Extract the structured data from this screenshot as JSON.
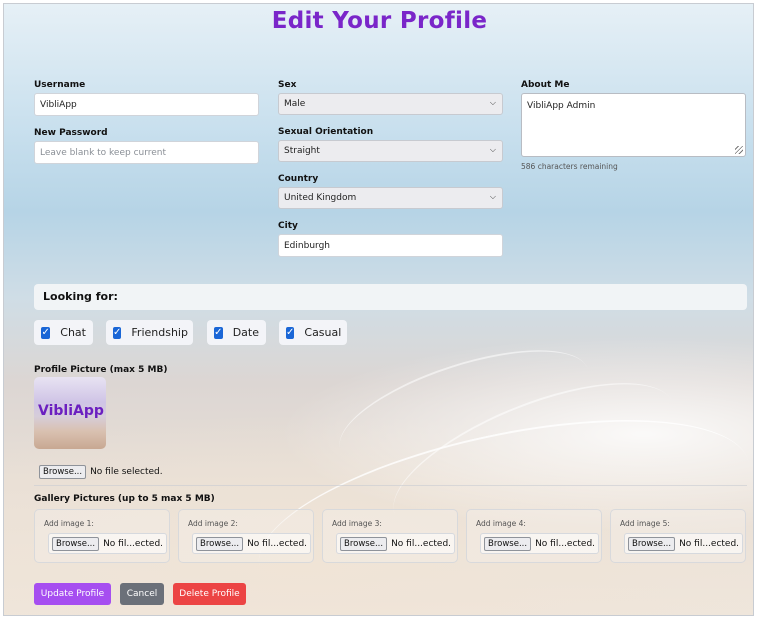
{
  "page_title": "Edit Your Profile",
  "username": {
    "label": "Username",
    "value": "VibliApp"
  },
  "new_password": {
    "label": "New Password",
    "placeholder": "Leave blank to keep current"
  },
  "sex": {
    "label": "Sex",
    "value": "Male"
  },
  "orientation": {
    "label": "Sexual Orientation",
    "value": "Straight"
  },
  "country": {
    "label": "Country",
    "value": "United Kingdom"
  },
  "city": {
    "label": "City",
    "value": "Edinburgh"
  },
  "about": {
    "label": "About Me",
    "value": "VibliApp Admin",
    "remaining": "586 characters remaining"
  },
  "looking_for": {
    "title": "Looking for:",
    "options": [
      {
        "label": "Chat",
        "checked": true
      },
      {
        "label": "Friendship",
        "checked": true
      },
      {
        "label": "Date",
        "checked": true
      },
      {
        "label": "Casual",
        "checked": true
      }
    ]
  },
  "profile_picture": {
    "label": "Profile Picture (max 5 MB)",
    "image_text": "VibliApp",
    "browse": "Browse...",
    "file_status": "No file selected."
  },
  "gallery": {
    "label": "Gallery Pictures (up to 5 max 5 MB)",
    "slots": [
      {
        "label": "Add image 1:",
        "browse": "Browse...",
        "status": "No fil...ected."
      },
      {
        "label": "Add image 2:",
        "browse": "Browse...",
        "status": "No fil...ected."
      },
      {
        "label": "Add image 3:",
        "browse": "Browse...",
        "status": "No fil...ected."
      },
      {
        "label": "Add image 4:",
        "browse": "Browse...",
        "status": "No fil...ected."
      },
      {
        "label": "Add image 5:",
        "browse": "Browse...",
        "status": "No fil...ected."
      }
    ]
  },
  "actions": {
    "update": "Update Profile",
    "cancel": "Cancel",
    "delete": "Delete Profile"
  },
  "colors": {
    "title": "#7a26c9",
    "update": "#a64ef0",
    "cancel": "#6b7079",
    "delete": "#ec4444",
    "checkbox": "#1a66d6"
  }
}
